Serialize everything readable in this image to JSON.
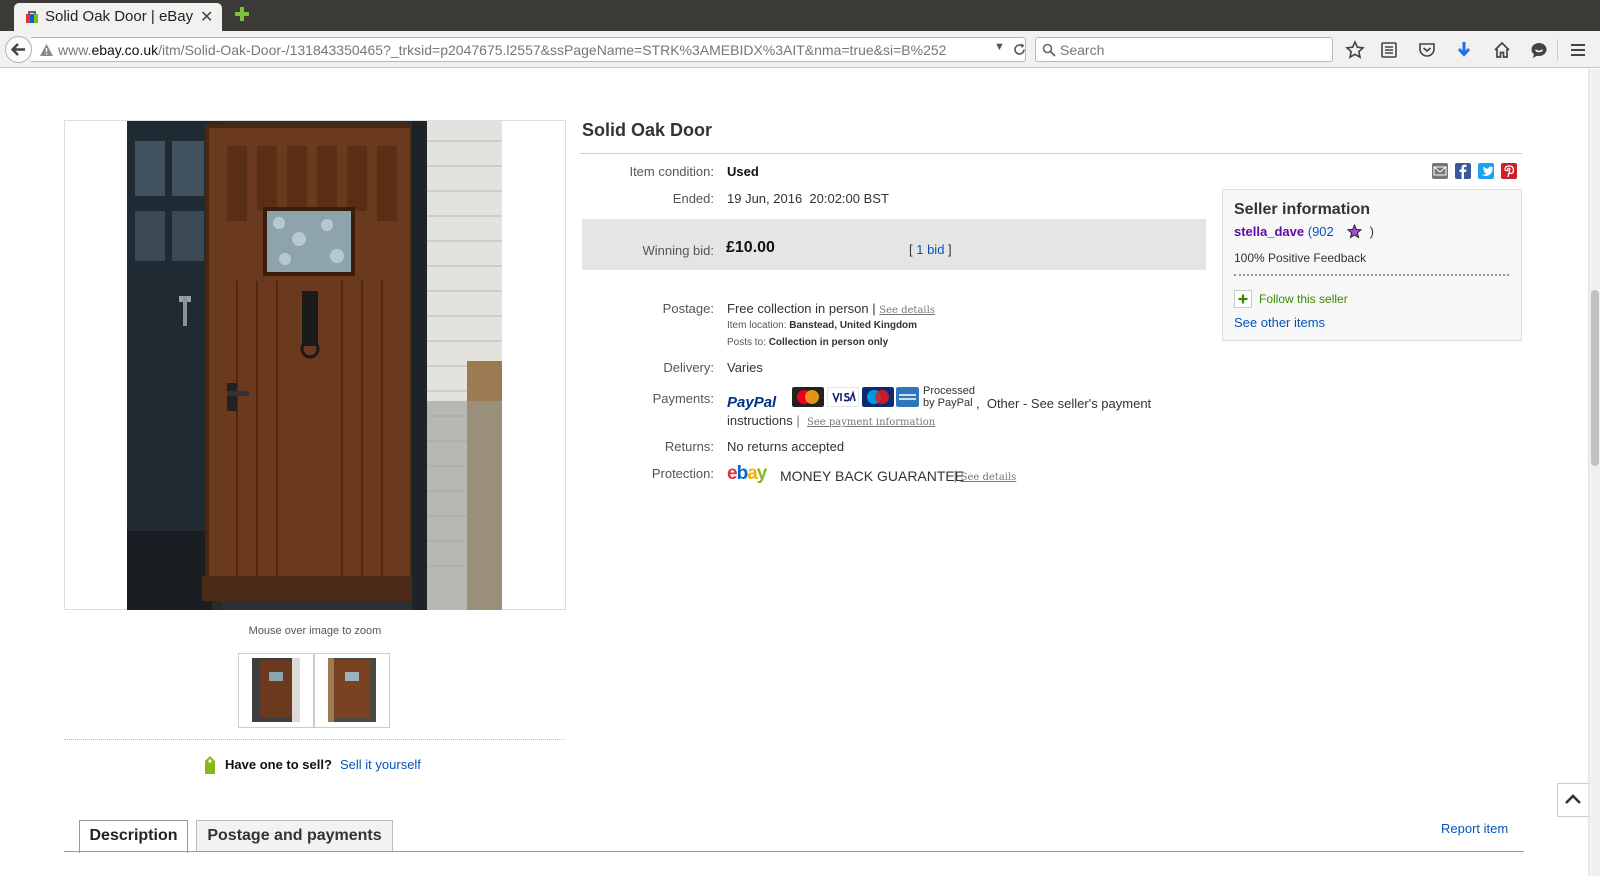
{
  "browser": {
    "tab_title": "Solid Oak Door | eBay",
    "url_prefix": "www.",
    "url_domain": "ebay.co.uk",
    "url_rest": "/itm/Solid-Oak-Door-/131843350465?_trksid=p2047675.l2557&ssPageName=STRK%3AMEBIDX%3AIT&nma=true&si=B%252",
    "search_placeholder": "Search"
  },
  "gallery": {
    "zoom_hint": "Mouse over image to zoom",
    "thumbnails": [
      "door-photo-1",
      "door-photo-2"
    ]
  },
  "sell": {
    "question": "Have one to sell?",
    "link": "Sell it yourself"
  },
  "item": {
    "title": "Solid Oak Door",
    "condition_label": "Item condition:",
    "condition_value": "Used",
    "ended_label": "Ended:",
    "ended_value": "19 Jun, 2016  20:02:00 BST",
    "winning_bid_label": "Winning bid:",
    "winning_bid_value": "£10.00",
    "bids_open": "[ ",
    "bids_link": "1 bid",
    "bids_close": " ]",
    "postage_label": "Postage:",
    "postage_value": "Free collection in person",
    "postage_sep": " | ",
    "postage_see_details": "See details",
    "item_location_label": "Item location:",
    "item_location_value": "Banstead, United Kingdom",
    "posts_to_label": "Posts to:",
    "posts_to_value": "Collection in person only",
    "delivery_label": "Delivery:",
    "delivery_value": "Varies",
    "payments_label": "Payments:",
    "paypal": "PayPal",
    "processed_line1": "Processed",
    "processed_line2": "by PayPal",
    "payments_other_line1": ",  Other - See seller's payment",
    "payments_other_line2": "instructions",
    "payments_sep": " | ",
    "payment_info_link": "See payment information",
    "returns_label": "Returns:",
    "returns_value": "No returns accepted",
    "protection_label": "Protection:",
    "guarantee_text": "MONEY BACK GUARANTEE",
    "protection_sep": " | ",
    "protection_see_details": "See details"
  },
  "seller": {
    "heading": "Seller information",
    "name": "stella_dave",
    "feedback_open": " (",
    "feedback_score": "902",
    "feedback_close": " )",
    "positive": "100% Positive Feedback",
    "follow": "Follow this seller",
    "other_items": "See other items"
  },
  "page_tabs": {
    "description": "Description",
    "postage": "Postage and payments",
    "report": "Report item"
  }
}
